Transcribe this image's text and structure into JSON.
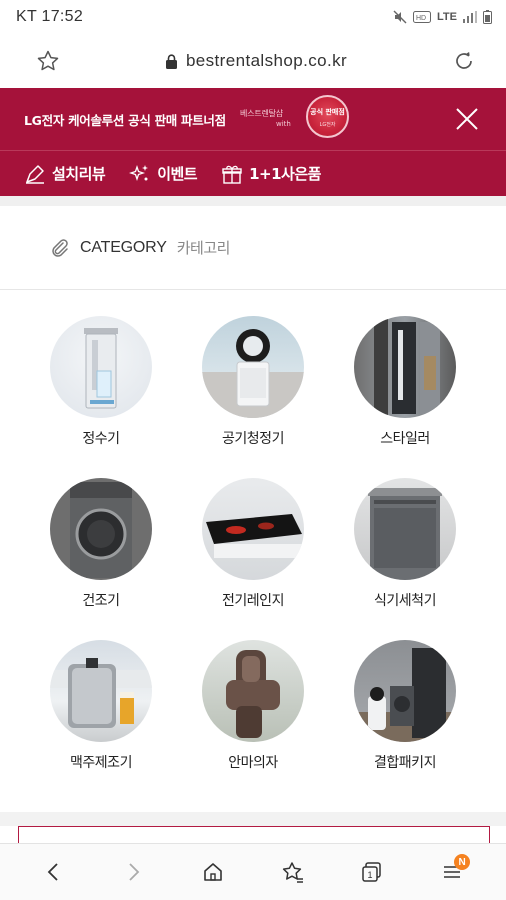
{
  "status_bar": {
    "carrier_time": "KT 17:52",
    "network": "LTE"
  },
  "browser": {
    "url": "bestrentalshop.co.kr"
  },
  "banner": {
    "text": "LG전자 케어솔루션 공식 판매 파트너점",
    "brand_line1": "베스트렌탈샵",
    "brand_line2": "with",
    "seal_text": "공식 판매점",
    "seal_sub": "LG전자"
  },
  "quick_nav": [
    {
      "label": "설치리뷰",
      "icon": "pencil-icon"
    },
    {
      "label": "이벤트",
      "icon": "sparkle-icon"
    },
    {
      "label": "1+1사은품",
      "icon": "gift-icon"
    }
  ],
  "category": {
    "title": "CATEGORY",
    "subtitle": "카테고리"
  },
  "items": [
    {
      "label": "정수기",
      "icon": "water-purifier-image"
    },
    {
      "label": "공기청정기",
      "icon": "air-purifier-image"
    },
    {
      "label": "스타일러",
      "icon": "styler-image"
    },
    {
      "label": "건조기",
      "icon": "dryer-image"
    },
    {
      "label": "전기레인지",
      "icon": "electric-range-image"
    },
    {
      "label": "식기세척기",
      "icon": "dishwasher-image"
    },
    {
      "label": "맥주제조기",
      "icon": "beer-maker-image"
    },
    {
      "label": "안마의자",
      "icon": "massage-chair-image"
    },
    {
      "label": "결합패키지",
      "icon": "package-image"
    }
  ],
  "bottom_nav": {
    "tabs_count": "1",
    "menu_badge": "N"
  },
  "colors": {
    "brand": "#a5123a",
    "badge": "#f58220"
  }
}
